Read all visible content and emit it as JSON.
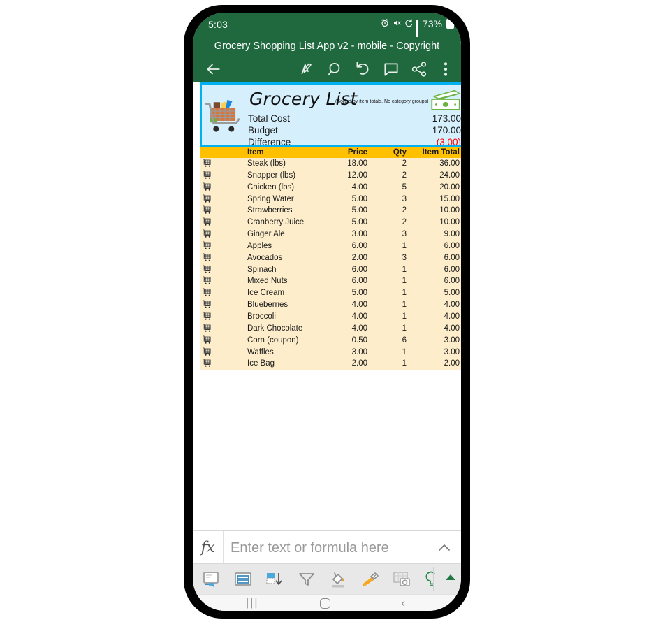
{
  "status_bar": {
    "time": "5:03",
    "battery_percent": "73%",
    "icons": [
      "alarm-icon",
      "mute-icon",
      "sync-icon",
      "signal-icon",
      "battery-icon"
    ]
  },
  "app": {
    "title": "Grocery Shopping List App v2 - mobile - Copyright",
    "accent_green": "#20693f",
    "toolbar_icons": [
      "back-arrow-icon",
      "edit-pen-icon",
      "search-icon",
      "undo-icon",
      "comment-icon",
      "share-icon",
      "overflow-menu-icon"
    ]
  },
  "sheet_header": {
    "title": "Grocery List",
    "subtitle": "(Sorted by item totals. No category groups)",
    "card_bg": "#d6effc",
    "card_border": "#00b0f0",
    "negative_color": "#ff0000",
    "summary": [
      {
        "label": "Total Cost",
        "value": "173.00"
      },
      {
        "label": "Budget",
        "value": "170.00"
      },
      {
        "label": "Difference",
        "value": "(3.00)"
      }
    ]
  },
  "table": {
    "header_bg": "#ffc000",
    "row_bg": "#fdedca",
    "columns": [
      "Item",
      "Price",
      "Qty",
      "Item Total"
    ],
    "rows": [
      {
        "item": "Steak (lbs)",
        "price": "18.00",
        "qty": "2",
        "total": "36.00"
      },
      {
        "item": "Snapper (lbs)",
        "price": "12.00",
        "qty": "2",
        "total": "24.00"
      },
      {
        "item": "Chicken (lbs)",
        "price": "4.00",
        "qty": "5",
        "total": "20.00"
      },
      {
        "item": "Spring Water",
        "price": "5.00",
        "qty": "3",
        "total": "15.00"
      },
      {
        "item": "Strawberries",
        "price": "5.00",
        "qty": "2",
        "total": "10.00"
      },
      {
        "item": "Cranberry Juice",
        "price": "5.00",
        "qty": "2",
        "total": "10.00"
      },
      {
        "item": "Ginger Ale",
        "price": "3.00",
        "qty": "3",
        "total": "9.00"
      },
      {
        "item": "Apples",
        "price": "6.00",
        "qty": "1",
        "total": "6.00"
      },
      {
        "item": "Avocados",
        "price": "2.00",
        "qty": "3",
        "total": "6.00"
      },
      {
        "item": "Spinach",
        "price": "6.00",
        "qty": "1",
        "total": "6.00"
      },
      {
        "item": "Mixed Nuts",
        "price": "6.00",
        "qty": "1",
        "total": "6.00"
      },
      {
        "item": "Ice Cream",
        "price": "5.00",
        "qty": "1",
        "total": "5.00"
      },
      {
        "item": "Blueberries",
        "price": "4.00",
        "qty": "1",
        "total": "4.00"
      },
      {
        "item": "Broccoli",
        "price": "4.00",
        "qty": "1",
        "total": "4.00"
      },
      {
        "item": "Dark Chocolate",
        "price": "4.00",
        "qty": "1",
        "total": "4.00"
      },
      {
        "item": "Corn (coupon)",
        "price": "0.50",
        "qty": "6",
        "total": "3.00"
      },
      {
        "item": "Waffles",
        "price": "3.00",
        "qty": "1",
        "total": "3.00"
      },
      {
        "item": "Ice Bag",
        "price": "2.00",
        "qty": "1",
        "total": "2.00"
      }
    ]
  },
  "formula_bar": {
    "fx_label": "fx",
    "placeholder": "Enter text or formula here",
    "value": "",
    "expand_icon": "chevron-up-icon"
  },
  "bottom_toolbar": {
    "icons": [
      "freeze-panes-icon",
      "view-layout-icon",
      "sort-icon",
      "filter-icon",
      "fill-color-icon",
      "format-painter-icon",
      "camera-grid-icon",
      "bulb-icon"
    ],
    "expand_icon": "caret-up-icon"
  },
  "nav_bar": {
    "recent_label": "|||",
    "home_label": "home-icon",
    "back_label": "‹"
  }
}
